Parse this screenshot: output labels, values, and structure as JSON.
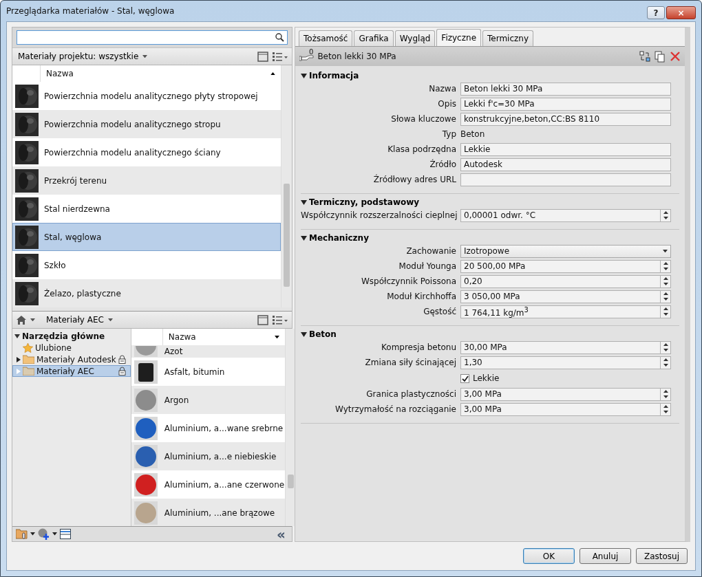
{
  "window": {
    "title": "Przeglądarka materiałów - Stal, węglowa",
    "help": "?",
    "close": "×"
  },
  "project_browser": {
    "filter": "Materiały projektu: wszystkie",
    "column": "Nazwa",
    "items": [
      {
        "name": "Powierzchnia modelu analitycznego płyty stropowej",
        "selected": false
      },
      {
        "name": "Powierzchnia modelu analitycznego stropu",
        "selected": false
      },
      {
        "name": "Powierzchnia modelu analitycznego ściany",
        "selected": false
      },
      {
        "name": "Przekrój terenu",
        "selected": false
      },
      {
        "name": "Stal nierdzewna",
        "selected": false
      },
      {
        "name": "Stal, węglowa",
        "selected": true
      },
      {
        "name": "Szkło",
        "selected": false
      },
      {
        "name": "Żelazo, plastyczne",
        "selected": false
      }
    ]
  },
  "library": {
    "breadcrumb": "Materiały AEC",
    "tree": [
      {
        "label": "Narzędzia główne",
        "kind": "root",
        "expanded": true,
        "selected": false,
        "children": [
          {
            "label": "Ulubione",
            "kind": "favorites",
            "selected": false,
            "locked": false
          },
          {
            "label": "Materiały Autodesk",
            "kind": "folder",
            "selected": false,
            "locked": true
          },
          {
            "label": "Materiały AEC",
            "kind": "folder",
            "selected": true,
            "locked": true
          }
        ]
      }
    ],
    "column": "Nazwa",
    "items": [
      {
        "name": "Azot",
        "kind": "sphere",
        "color": "#9a9a9a"
      },
      {
        "name": "Asfalt, bitumin",
        "kind": "cylinder",
        "color": "#1e1e1e"
      },
      {
        "name": "Argon",
        "kind": "sphere",
        "color": "#8c8c8c"
      },
      {
        "name": "Aluminium, a...wane srebrne",
        "kind": "sphere",
        "color": "#1f5fbf"
      },
      {
        "name": "Aluminium, a...e niebieskie",
        "kind": "sphere",
        "color": "#2a5fb0"
      },
      {
        "name": "Aluminium, a...ane czerwone",
        "kind": "sphere",
        "color": "#d02020"
      },
      {
        "name": "Aluminium, ...ane brązowe",
        "kind": "sphere",
        "color": "#b8a58e"
      }
    ],
    "collapse": "«"
  },
  "tabs": [
    {
      "label": "Tożsamość",
      "selected": false
    },
    {
      "label": "Grafika",
      "selected": false
    },
    {
      "label": "Wygląd",
      "selected": false
    },
    {
      "label": "Fizyczne",
      "selected": true
    },
    {
      "label": "Termiczny",
      "selected": false
    }
  ],
  "asset": {
    "count": "0",
    "name": "Beton lekki 30 MPa"
  },
  "sections": [
    {
      "title": "Informacja",
      "expanded": true,
      "rows": [
        {
          "kind": "text",
          "label": "Nazwa",
          "value": "Beton lekki 30 MPa"
        },
        {
          "kind": "text",
          "label": "Opis",
          "value": "Lekki f'c=30 MPa"
        },
        {
          "kind": "text",
          "label": "Słowa kluczowe",
          "value": "konstrukcyjne,beton,CC:BS 8110"
        },
        {
          "kind": "static",
          "label": "Typ",
          "value": "Beton"
        },
        {
          "kind": "text",
          "label": "Klasa podrzędna",
          "value": "Lekkie"
        },
        {
          "kind": "text",
          "label": "Źródło",
          "value": "Autodesk"
        },
        {
          "kind": "text",
          "label": "Źródłowy adres URL"
        }
      ]
    },
    {
      "title": "Termiczny, podstawowy",
      "expanded": true,
      "rows": [
        {
          "kind": "spinner",
          "label": "Współczynnik rozszerzalności cieplnej",
          "value": "0,00001 odwr. °C"
        }
      ]
    },
    {
      "title": "Mechaniczny",
      "expanded": true,
      "rows": [
        {
          "kind": "dropdown",
          "label": "Zachowanie",
          "value": "Izotropowe"
        },
        {
          "kind": "spinner",
          "label": "Moduł Younga",
          "value": "20 500,00 MPa"
        },
        {
          "kind": "spinner",
          "label": "Współczynnik Poissona",
          "value": "0,20"
        },
        {
          "kind": "spinner",
          "label": "Moduł Kirchhoffa",
          "value": "3 050,00 MPa"
        },
        {
          "kind": "spinner",
          "label": "Gęstość",
          "value": "1 764,11 kg/m$^{3}$"
        }
      ]
    },
    {
      "title": "Beton",
      "expanded": true,
      "rows": [
        {
          "kind": "spinner",
          "label": "Kompresja betonu",
          "value": "30,00 MPa"
        },
        {
          "kind": "spinner",
          "label": "Zmiana siły ścinającej",
          "value": "1,30"
        },
        {
          "kind": "checkbox",
          "label": "Lekkie",
          "checked": true
        },
        {
          "kind": "spinner",
          "label": "Granica plastyczności",
          "value": "3,00 MPa"
        },
        {
          "kind": "spinner",
          "label": "Wytrzymałość na rozciąganie",
          "value": "3,00 MPa"
        }
      ]
    }
  ],
  "buttons": [
    {
      "label": "OK",
      "default": true
    },
    {
      "label": "Anuluj",
      "default": false
    },
    {
      "label": "Zastosuj",
      "default": false
    }
  ]
}
